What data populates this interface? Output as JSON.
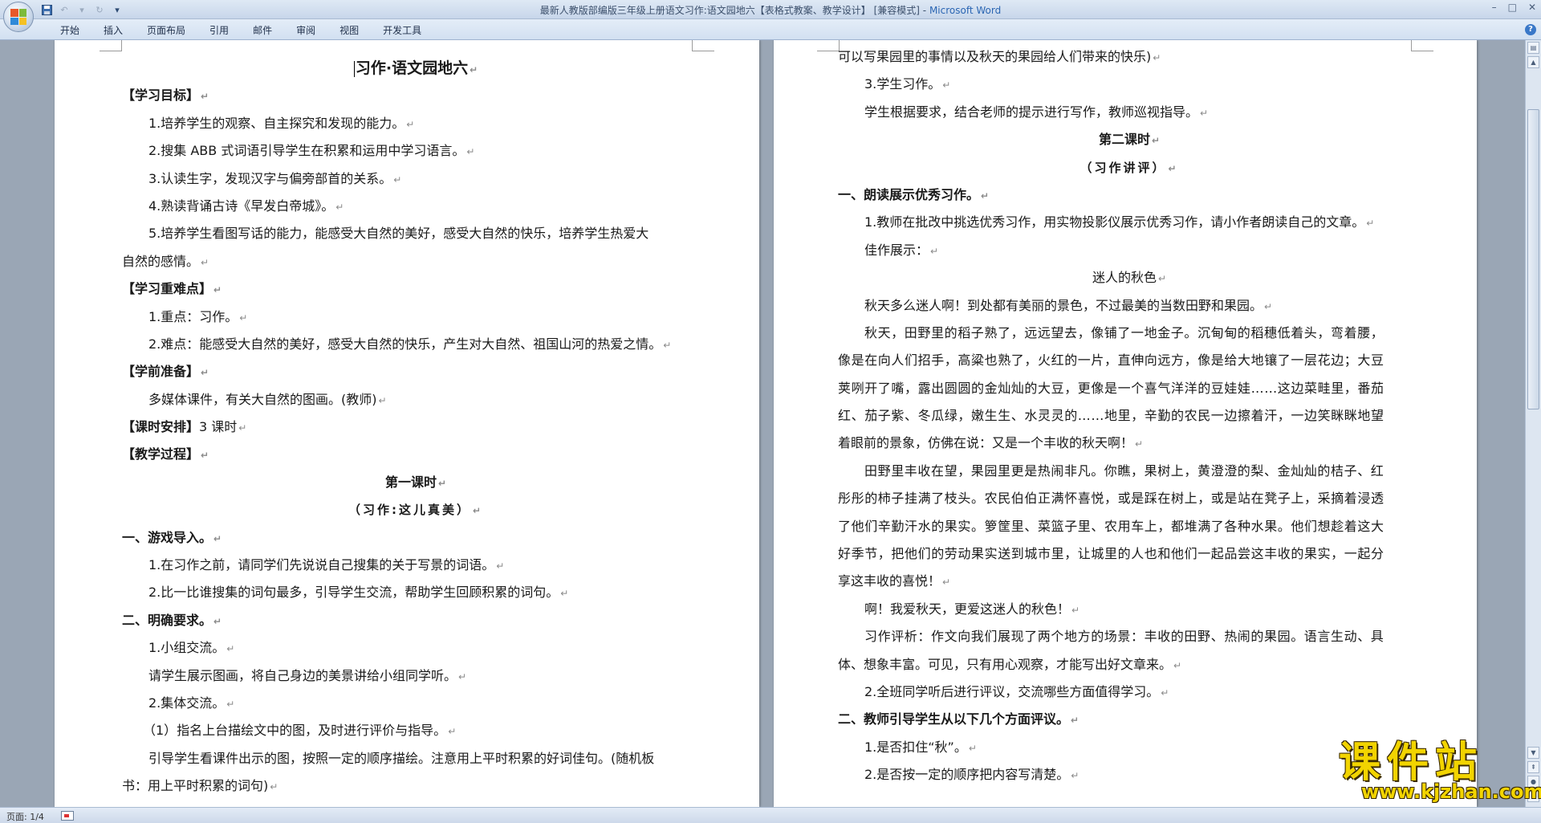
{
  "window": {
    "title": "最新人教版部编版三年级上册语文习作:语文园地六【表格式教案、教学设计】 [兼容模式] - ",
    "app_name": "Microsoft Word"
  },
  "ribbon": {
    "tabs": [
      "开始",
      "插入",
      "页面布局",
      "引用",
      "邮件",
      "审阅",
      "视图",
      "开发工具"
    ]
  },
  "page_left": {
    "lines": [
      "习作·语文园地六",
      "【学习目标】",
      "1.培养学生的观察、自主探究和发现的能力。",
      "2.搜集 ABB 式词语引导学生在积累和运用中学习语言。",
      "3.认读生字，发现汉字与偏旁部首的关系。",
      "4.熟读背诵古诗《早发白帝城》。",
      "5.培养学生看图写话的能力，能感受大自然的美好，感受大自然的快乐，培养学生热爱大",
      "自然的感情。",
      "【学习重难点】",
      "1.重点：习作。",
      "2.难点：能感受大自然的美好，感受大自然的快乐，产生对大自然、祖国山河的热爱之情。",
      "【学前准备】",
      "多媒体课件，有关大自然的图画。(教师)",
      "【课时安排】",
      "3 课时",
      "【教学过程】",
      "第一课时",
      "（习作:这儿真美）",
      "一、游戏导入。",
      "1.在习作之前，请同学们先说说自己搜集的关于写景的词语。",
      "2.比一比谁搜集的词句最多，引导学生交流，帮助学生回顾积累的词句。",
      "二、明确要求。",
      "1.小组交流。",
      "请学生展示图画，将自己身边的美景讲给小组同学听。",
      "2.集体交流。",
      "（1）指名上台描绘文中的图，及时进行评价与指导。",
      "引导学生看课件出示的图，按照一定的顺序描绘。注意用上平时积累的好词佳句。(随机板",
      "书：用上平时积累的词句)"
    ]
  },
  "page_right": {
    "lines": [
      "可以写果园里的事情以及秋天的果园给人们带来的快乐)",
      "3.学生习作。",
      "学生根据要求，结合老师的提示进行写作，教师巡视指导。",
      "第二课时",
      "（习作讲评）",
      "一、朗读展示优秀习作。",
      "1.教师在批改中挑选优秀习作，用实物投影仪展示优秀习作，请小作者朗读自己的文章。",
      "佳作展示：",
      "迷人的秋色",
      "秋天多么迷人啊！到处都有美丽的景色，不过最美的当数田野和果园。",
      "秋天，田野里的稻子熟了，远远望去，像铺了一地金子。沉甸甸的稻穗低着头，弯着腰，",
      "像是在向人们招手，高粱也熟了，火红的一片，直伸向远方，像是给大地镶了一层花边；大豆",
      "荚咧开了嘴，露出圆圆的金灿灿的大豆，更像是一个喜气洋洋的豆娃娃……这边菜畦里，番茄",
      "红、茄子紫、冬瓜绿，嫩生生、水灵灵的……地里，辛勤的农民一边擦着汗，一边笑眯眯地望",
      "着眼前的景象，仿佛在说：又是一个丰收的秋天啊！",
      "田野里丰收在望，果园里更是热闹非凡。你瞧，果树上，黄澄澄的梨、金灿灿的桔子、红",
      "彤彤的柿子挂满了枝头。农民伯伯正满怀喜悦，或是踩在树上，或是站在凳子上，采摘着浸透",
      "了他们辛勤汗水的果实。箩筐里、菜篮子里、农用车上，都堆满了各种水果。他们想趁着这大",
      "好季节，把他们的劳动果实送到城市里，让城里的人也和他们一起品尝这丰收的果实，一起分",
      "享这丰收的喜悦！",
      "啊！我爱秋天，更爱这迷人的秋色！",
      "习作评析：作文向我们展现了两个地方的场景：丰收的田野、热闹的果园。语言生动、具",
      "体、想象丰富。可见，只有用心观察，才能写出好文章来。",
      "2.全班同学听后进行评议，交流哪些方面值得学习。",
      "二、教师引导学生从以下几个方面评议。",
      "1.是否扣住“秋”。",
      "2.是否按一定的顺序把内容写清楚。"
    ]
  },
  "statusbar": {
    "page_info": "页面: 1/4"
  },
  "watermark": {
    "text": "课件站",
    "url": "www.kjzhan.com"
  }
}
